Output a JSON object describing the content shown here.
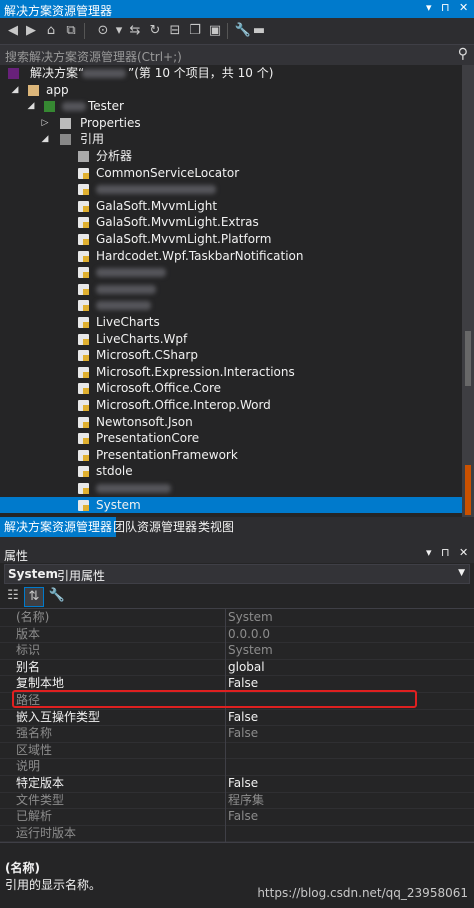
{
  "explorer": {
    "title": "解决方案资源管理器",
    "search_placeholder": "搜索解决方案资源管理器(Ctrl+;)",
    "solution_label": "解决方案“",
    "solution_suffix": "”(第 10 个项目，共 10 个)",
    "app_label": "app",
    "project_label": "Tester",
    "properties_label": "Properties",
    "references_label": "引用",
    "analyzers_label": "分析器",
    "references": [
      "CommonServiceLocator",
      "",
      "GalaSoft.MvvmLight",
      "GalaSoft.MvvmLight.Extras",
      "GalaSoft.MvvmLight.Platform",
      "Hardcodet.Wpf.TaskbarNotification",
      "",
      "",
      "",
      "LiveCharts",
      "LiveCharts.Wpf",
      "Microsoft.CSharp",
      "Microsoft.Expression.Interactions",
      "Microsoft.Office.Core",
      "Microsoft.Office.Interop.Word",
      "Newtonsoft.Json",
      "PresentationCore",
      "PresentationFramework",
      "stdole",
      "",
      "System"
    ],
    "selected_reference": "System",
    "scroll_fraction": 0.78
  },
  "tabs": [
    "解决方案资源管理器",
    "团队资源管理器",
    "类视图"
  ],
  "properties": {
    "title": "属性",
    "object_name": "System",
    "object_type": "引用属性",
    "rows": [
      {
        "name": "(名称)",
        "value": "System",
        "readonly": true
      },
      {
        "name": "版本",
        "value": "0.0.0.0",
        "readonly": true
      },
      {
        "name": "标识",
        "value": "System",
        "readonly": true
      },
      {
        "name": "别名",
        "value": "global",
        "readonly": false
      },
      {
        "name": "复制本地",
        "value": "False",
        "readonly": false
      },
      {
        "name": "路径",
        "value": "",
        "readonly": true
      },
      {
        "name": "嵌入互操作类型",
        "value": "False",
        "readonly": false
      },
      {
        "name": "强名称",
        "value": "False",
        "readonly": true
      },
      {
        "name": "区域性",
        "value": "",
        "readonly": true
      },
      {
        "name": "说明",
        "value": "",
        "readonly": true
      },
      {
        "name": "特定版本",
        "value": "False",
        "readonly": false
      },
      {
        "name": "文件类型",
        "value": "程序集",
        "readonly": true
      },
      {
        "name": "已解析",
        "value": "False",
        "readonly": true
      },
      {
        "name": "运行时版本",
        "value": "",
        "readonly": true
      }
    ],
    "desc_title": "(名称)",
    "desc_text": "引用的显示名称。"
  },
  "watermark": "https://blog.csdn.net/qq_23958061",
  "colors": {
    "accent": "#007acc",
    "highlight_box": "#e02020"
  }
}
